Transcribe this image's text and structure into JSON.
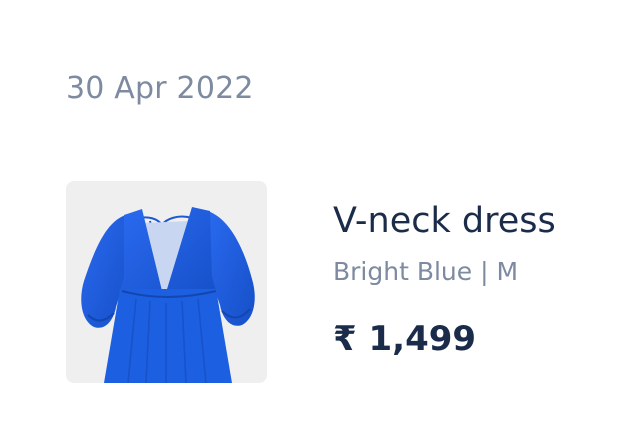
{
  "order": {
    "date": "30 Apr 2022"
  },
  "product": {
    "name": "V-neck dress",
    "variant": "Bright Blue | M",
    "price": "₹ 1,499",
    "image_icon": "dress-thumbnail",
    "color_hex": "#1f5fd8"
  },
  "colors": {
    "primary_text": "#1b2b4a",
    "secondary_text": "#7d8aa0",
    "image_background": "#efefef"
  }
}
